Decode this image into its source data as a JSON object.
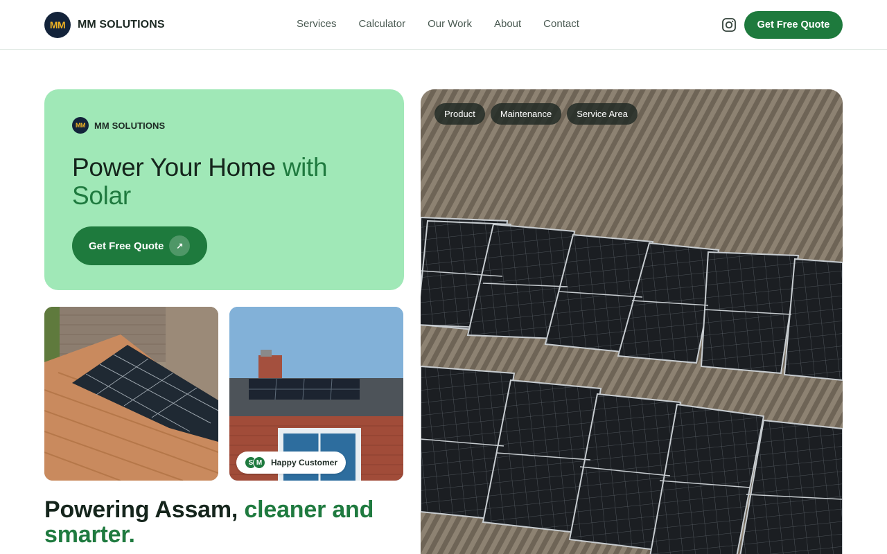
{
  "header": {
    "logo_text": "MM",
    "brand": "MM SOLUTIONS",
    "nav": [
      "Services",
      "Calculator",
      "Our Work",
      "About",
      "Contact"
    ],
    "instagram_icon": "instagram-icon",
    "cta": "Get Free Quote"
  },
  "hero": {
    "logo_text": "MM",
    "brand": "MM SOLUTIONS",
    "title_main": "Power Your Home ",
    "title_accent": "with Solar",
    "button": "Get Free Quote",
    "button_icon": "arrow-up-right-icon"
  },
  "gallery": {
    "badge": {
      "avatars": [
        "S",
        "M"
      ],
      "label": "Happy Customer"
    }
  },
  "tagline": {
    "main": "Powering Assam, ",
    "accent": "cleaner and smarter."
  },
  "feature_image": {
    "chips": [
      "Product",
      "Maintenance",
      "Service Area"
    ]
  },
  "colors": {
    "brand_green": "#1e7a3d",
    "hero_bg": "#a0e8b7",
    "logo_bg": "#13233a",
    "logo_text": "#f0b323"
  }
}
